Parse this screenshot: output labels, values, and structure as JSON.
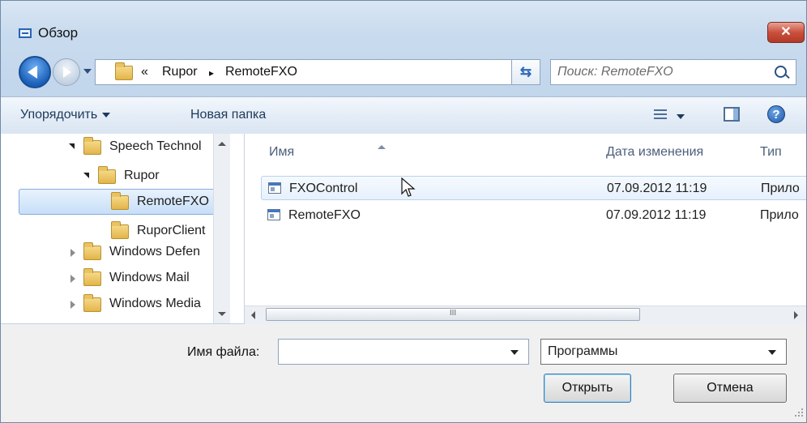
{
  "window": {
    "title": "Обзор",
    "close_label": "✕"
  },
  "navigation": {
    "breadcrumb": {
      "prefix": "«",
      "items": [
        "Rupor",
        "RemoteFXO"
      ],
      "separator": "▸"
    },
    "search_placeholder": "Поиск: RemoteFXO"
  },
  "toolbar": {
    "organize_label": "Упорядочить",
    "new_folder_label": "Новая папка"
  },
  "tree": {
    "items": [
      {
        "label": "Speech Technol",
        "expander": "open"
      },
      {
        "label": "Rupor",
        "expander": "open"
      },
      {
        "label": "RemoteFXO",
        "expander": "none",
        "selected": true
      },
      {
        "label": "RuporClient",
        "expander": "none"
      },
      {
        "label": "Windows Defen",
        "expander": "closed"
      },
      {
        "label": "Windows Mail",
        "expander": "closed"
      },
      {
        "label": "Windows Media",
        "expander": "closed"
      }
    ]
  },
  "files": {
    "columns": [
      "Имя",
      "Дата изменения",
      "Тип"
    ],
    "rows": [
      {
        "name": "FXOControl",
        "date": "07.09.2012 11:19",
        "type": "Прило",
        "hover": true
      },
      {
        "name": "RemoteFXO",
        "date": "07.09.2012 11:19",
        "type": "Прило"
      }
    ],
    "hscroll_thumb_label": "III"
  },
  "footer": {
    "filename_label": "Имя файла:",
    "filename_value": "",
    "filter_value": "Программы",
    "open_label": "Открыть",
    "cancel_label": "Отмена"
  },
  "colors": {
    "accent": "#2a63b5",
    "selection": "#c7dff8",
    "close": "#c9503d"
  }
}
